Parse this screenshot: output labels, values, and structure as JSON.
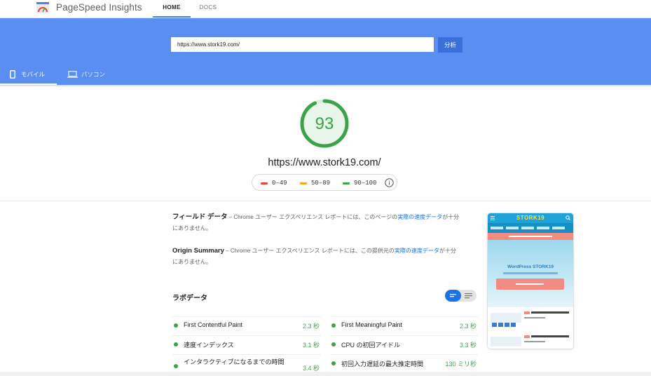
{
  "nav": {
    "brand": "PageSpeed Insights",
    "home": "HOME",
    "docs": "DOCS"
  },
  "search": {
    "url": "https://www.stork19.com/",
    "analyze": "分析"
  },
  "tabs": {
    "mobile": "モバイル",
    "desktop": "パソコン"
  },
  "score": {
    "value": "93",
    "fraction": 0.93,
    "url": "https://www.stork19.com/",
    "color": "#3ca24c"
  },
  "legend": [
    {
      "range": "0–49",
      "color": "#e8453c"
    },
    {
      "range": "50–89",
      "color": "#f5a623"
    },
    {
      "range": "90–100",
      "color": "#3ca24c"
    }
  ],
  "field_data": {
    "title": "フィールド データ",
    "text_prefix": " – Chrome ユーザー エクスペリエンス レポートには、このページの",
    "link": "実際の速度データ",
    "text_suffix": "が十分にありません。"
  },
  "origin_summary": {
    "title": "Origin Summary",
    "text_prefix": " – Chrome ユーザー エクスペリエンス レポートには、この提供元の",
    "link": "実際の速度データ",
    "text_suffix": "が十分にありません。"
  },
  "lab": {
    "title": "ラボデータ",
    "metrics_left": [
      {
        "label": "First Contentful Paint",
        "value": "2.3 秒"
      },
      {
        "label": "速度インデックス",
        "value": "3.1 秒"
      },
      {
        "label": "インタラクティブになるまでの時間",
        "value": "3.4 秒"
      }
    ],
    "metrics_right": [
      {
        "label": "First Meaningful Paint",
        "value": "2.3 秒"
      },
      {
        "label": "CPU の初回アイドル",
        "value": "3.3 秒"
      },
      {
        "label": "初回入力遅延の最大推定時間",
        "value": "130 ミリ秒"
      }
    ]
  },
  "thumbnail": {
    "logo": "STORK19",
    "hero_title": "WordPress STORK19"
  }
}
